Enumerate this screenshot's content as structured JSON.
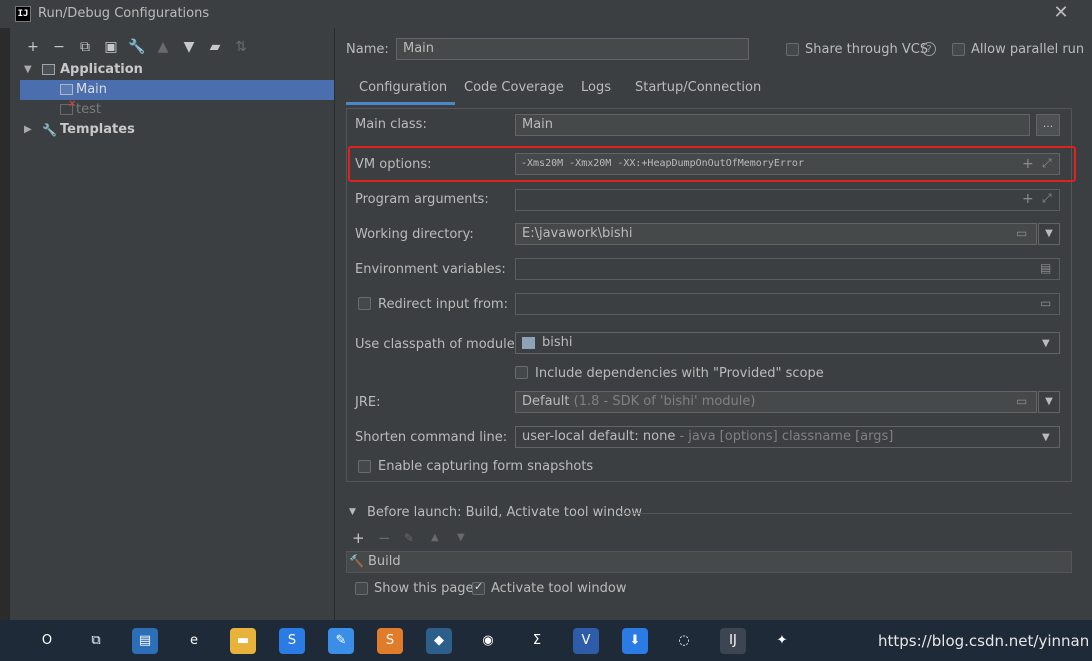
{
  "window": {
    "title": "Run/Debug Configurations",
    "logo": "IJ",
    "close_glyph": "✕"
  },
  "toolbar": [
    {
      "name": "add-icon",
      "glyph": "+"
    },
    {
      "name": "remove-icon",
      "glyph": "−"
    },
    {
      "name": "copy-icon",
      "glyph": "⧉"
    },
    {
      "name": "save-icon",
      "glyph": "▣"
    },
    {
      "name": "wrench-icon",
      "glyph": "🔧"
    },
    {
      "name": "move-up-icon",
      "glyph": "▲"
    },
    {
      "name": "move-down-icon",
      "glyph": "▼"
    },
    {
      "name": "folder-icon",
      "glyph": "▰"
    },
    {
      "name": "sort-icon",
      "glyph": "⇅"
    }
  ],
  "tree": {
    "application": "Application",
    "items": [
      "Main",
      "test"
    ],
    "templates": "Templates"
  },
  "header": {
    "name_label": "Name:",
    "name_value": "Main",
    "share_label": "Share through VCS",
    "help_glyph": "?",
    "parallel_label": "Allow parallel run"
  },
  "tabs": [
    "Configuration",
    "Code Coverage",
    "Logs",
    "Startup/Connection"
  ],
  "form": {
    "main_class_label": "Main class:",
    "main_class_value": "Main",
    "browse_glyph": "...",
    "vm_label": "VM options:",
    "vm_value": "-Xms20M -Xmx20M -XX:+HeapDumpOnOutOfMemoryError",
    "program_args_label": "Program arguments:",
    "working_dir_label": "Working directory:",
    "working_dir_value": "E:\\javawork\\bishi",
    "env_label": "Environment variables:",
    "redirect_label": "Redirect input from:",
    "classpath_label": "Use classpath of module:",
    "classpath_value": "bishi",
    "include_label": "Include dependencies with \"Provided\" scope",
    "jre_label": "JRE:",
    "jre_value": "Default",
    "jre_hint": "(1.8 - SDK of 'bishi' module)",
    "shorten_label": "Shorten command line:",
    "shorten_value": "user-local default: none",
    "shorten_hint": "- java [options] classname [args]",
    "capture_label": "Enable capturing form snapshots"
  },
  "before_launch": {
    "title": "Before launch: Build, Activate tool window",
    "items": [
      "Build"
    ],
    "show_page_label": "Show this page",
    "activate_label": "Activate tool window"
  },
  "taskbar": {
    "apps": [
      {
        "name": "cortana-icon",
        "glyph": "O",
        "color": "#1f2a38"
      },
      {
        "name": "task-view-icon",
        "glyph": "⧉",
        "color": "#1f2a38"
      },
      {
        "name": "computer-icon",
        "glyph": "▤",
        "color": "#2c6fb6"
      },
      {
        "name": "edge-icon",
        "glyph": "e",
        "color": "#1f2a38"
      },
      {
        "name": "file-explorer-icon",
        "glyph": "▬",
        "color": "#e8b33b"
      },
      {
        "name": "sogou-icon",
        "glyph": "S",
        "color": "#2a7be4"
      },
      {
        "name": "notes-icon",
        "glyph": "✎",
        "color": "#3b8ee8"
      },
      {
        "name": "sublime-icon",
        "glyph": "S",
        "color": "#e17c2a"
      },
      {
        "name": "mysql-icon",
        "glyph": "◆",
        "color": "#2c5f8a"
      },
      {
        "name": "chrome-icon",
        "glyph": "◉",
        "color": "#1f2a38"
      },
      {
        "name": "sigma-icon",
        "glyph": "Σ",
        "color": "#1f2a38"
      },
      {
        "name": "visio-icon",
        "glyph": "V",
        "color": "#2f5ca8"
      },
      {
        "name": "downloader-icon",
        "glyph": "⬇",
        "color": "#2a7be4"
      },
      {
        "name": "wechat-icon",
        "glyph": "◌",
        "color": "#1f2a38"
      },
      {
        "name": "intellij-icon",
        "glyph": "IJ",
        "color": "#3d4452"
      },
      {
        "name": "safari-icon",
        "glyph": "✦",
        "color": "#1f2a38"
      }
    ],
    "watermark": "https://blog.csdn.net/yinnan"
  },
  "colors": {
    "accent": "#4a88c7",
    "selection": "#4b6eaf",
    "highlight": "#e0221c"
  }
}
